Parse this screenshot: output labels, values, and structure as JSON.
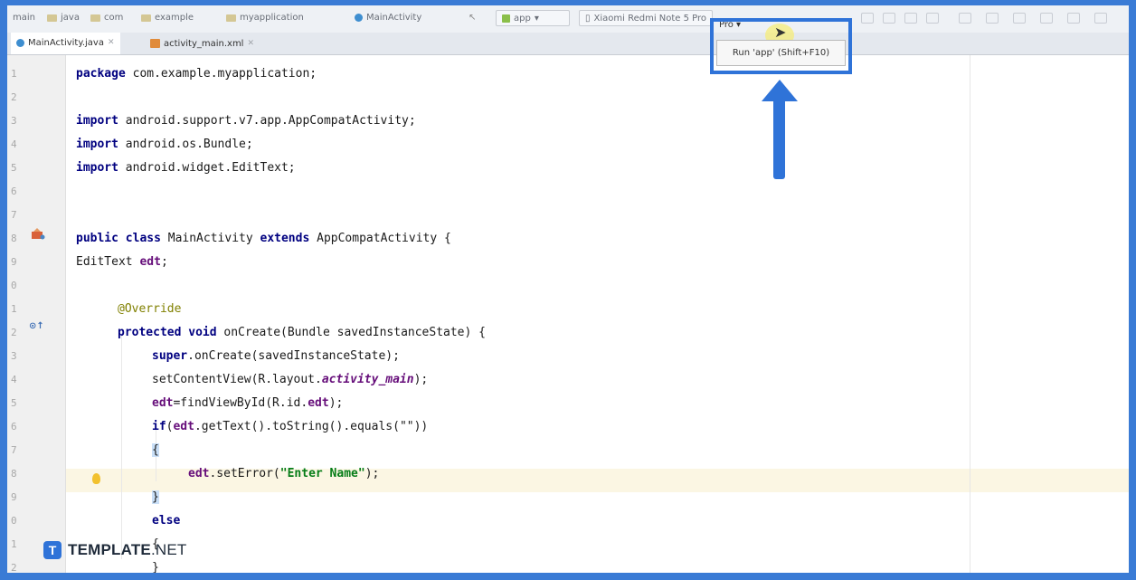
{
  "navbar": {
    "crumbs": [
      "main",
      "java",
      "com",
      "example",
      "myapplication",
      "MainActivity"
    ],
    "run_config": "app",
    "device": "Xiaomi Redmi Note 5 Pro"
  },
  "tabs": [
    {
      "label": "MainActivity.java",
      "icon": "class-icon"
    },
    {
      "label": "activity_main.xml",
      "icon": "xml-file-icon"
    }
  ],
  "run_tooltip": "Run 'app' (Shift+F10)",
  "code": {
    "package": "com.example.myapplication;",
    "imports": [
      "android.support.v7.app.AppCompatActivity;",
      "android.os.Bundle;",
      "android.widget.EditText;"
    ],
    "class_name": "MainActivity",
    "extends": "AppCompatActivity",
    "field_type": "EditText",
    "field_name": "edt",
    "annotation": "@Override",
    "method_sig": "onCreate(Bundle savedInstanceState) {",
    "super_call": "onCreate(savedInstanceState);",
    "set_content": "setContentView(R.layout.",
    "layout_name": "activity_main",
    "find_view": "=findViewById(R.id.",
    "if_cond": "(",
    "if_rest": ".getText().toString().equals(\"\"))",
    "set_error": ".setError(",
    "error_msg": "\"Enter Name\"",
    "else_kw": "else",
    "line_numbers": [
      "1",
      "2",
      "3",
      "4",
      "5",
      "6",
      "7",
      "8",
      "9",
      "0",
      "1",
      "2",
      "3",
      "4",
      "5",
      "6",
      "7",
      "8",
      "9",
      "0",
      "1",
      "2"
    ]
  },
  "colors": {
    "accent": "#3a7bd5",
    "keyword": "#000080",
    "string": "#067d17",
    "annotation": "#808000"
  },
  "watermark": {
    "logo_letter": "T",
    "brand": "TEMPLATE",
    "suffix": ".NET"
  }
}
